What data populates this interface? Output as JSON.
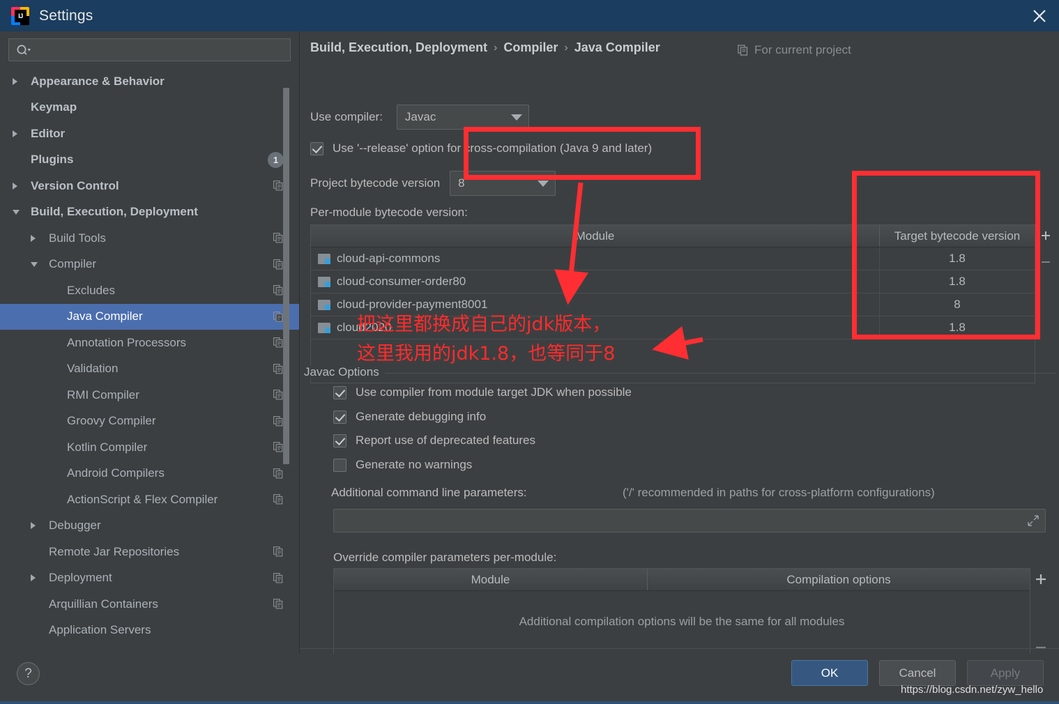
{
  "window": {
    "title": "Settings",
    "logo_text": "IJ",
    "close_label": "✕"
  },
  "sidebar": {
    "search": {
      "placeholder": "",
      "value": ""
    },
    "items": [
      {
        "label": "Appearance & Behavior",
        "indent": 0,
        "arrow": "right",
        "bold": true,
        "badge": null,
        "copy": false,
        "selected": false
      },
      {
        "label": "Keymap",
        "indent": 0,
        "arrow": "none",
        "bold": true,
        "badge": null,
        "copy": false,
        "selected": false
      },
      {
        "label": "Editor",
        "indent": 0,
        "arrow": "right",
        "bold": true,
        "badge": null,
        "copy": false,
        "selected": false
      },
      {
        "label": "Plugins",
        "indent": 0,
        "arrow": "none",
        "bold": true,
        "badge": "1",
        "copy": false,
        "selected": false
      },
      {
        "label": "Version Control",
        "indent": 0,
        "arrow": "right",
        "bold": true,
        "badge": null,
        "copy": true,
        "selected": false
      },
      {
        "label": "Build, Execution, Deployment",
        "indent": 0,
        "arrow": "down",
        "bold": true,
        "badge": null,
        "copy": false,
        "selected": false
      },
      {
        "label": "Build Tools",
        "indent": 1,
        "arrow": "right",
        "bold": false,
        "badge": null,
        "copy": true,
        "selected": false
      },
      {
        "label": "Compiler",
        "indent": 1,
        "arrow": "down",
        "bold": false,
        "badge": null,
        "copy": true,
        "selected": false
      },
      {
        "label": "Excludes",
        "indent": 2,
        "arrow": "none",
        "bold": false,
        "badge": null,
        "copy": true,
        "selected": false
      },
      {
        "label": "Java Compiler",
        "indent": 2,
        "arrow": "none",
        "bold": false,
        "badge": null,
        "copy": true,
        "selected": true
      },
      {
        "label": "Annotation Processors",
        "indent": 2,
        "arrow": "none",
        "bold": false,
        "badge": null,
        "copy": true,
        "selected": false
      },
      {
        "label": "Validation",
        "indent": 2,
        "arrow": "none",
        "bold": false,
        "badge": null,
        "copy": true,
        "selected": false
      },
      {
        "label": "RMI Compiler",
        "indent": 2,
        "arrow": "none",
        "bold": false,
        "badge": null,
        "copy": true,
        "selected": false
      },
      {
        "label": "Groovy Compiler",
        "indent": 2,
        "arrow": "none",
        "bold": false,
        "badge": null,
        "copy": true,
        "selected": false
      },
      {
        "label": "Kotlin Compiler",
        "indent": 2,
        "arrow": "none",
        "bold": false,
        "badge": null,
        "copy": true,
        "selected": false
      },
      {
        "label": "Android Compilers",
        "indent": 2,
        "arrow": "none",
        "bold": false,
        "badge": null,
        "copy": true,
        "selected": false
      },
      {
        "label": "ActionScript & Flex Compiler",
        "indent": 2,
        "arrow": "none",
        "bold": false,
        "badge": null,
        "copy": true,
        "selected": false
      },
      {
        "label": "Debugger",
        "indent": 1,
        "arrow": "right",
        "bold": false,
        "badge": null,
        "copy": false,
        "selected": false
      },
      {
        "label": "Remote Jar Repositories",
        "indent": 1,
        "arrow": "none",
        "bold": false,
        "badge": null,
        "copy": true,
        "selected": false
      },
      {
        "label": "Deployment",
        "indent": 1,
        "arrow": "right",
        "bold": false,
        "badge": null,
        "copy": true,
        "selected": false
      },
      {
        "label": "Arquillian Containers",
        "indent": 1,
        "arrow": "none",
        "bold": false,
        "badge": null,
        "copy": true,
        "selected": false
      },
      {
        "label": "Application Servers",
        "indent": 1,
        "arrow": "none",
        "bold": false,
        "badge": null,
        "copy": false,
        "selected": false
      }
    ]
  },
  "main": {
    "breadcrumb": {
      "part1": "Build, Execution, Deployment",
      "part2": "Compiler",
      "part3": "Java Compiler",
      "separator": "›"
    },
    "for_current_project": "For current project",
    "use_compiler_label": "Use compiler:",
    "use_compiler_value": "Javac",
    "release_option_label": "Use '--release' option for cross-compilation (Java 9 and later)",
    "release_option_checked": true,
    "project_bytecode_label": "Project bytecode version",
    "project_bytecode_value": "8",
    "per_module_label": "Per-module bytecode version:",
    "module_table": {
      "headers": [
        "Module",
        "Target bytecode version"
      ],
      "rows": [
        {
          "module": "cloud-api-commons",
          "target": "1.8"
        },
        {
          "module": "cloud-consumer-order80",
          "target": "1.8"
        },
        {
          "module": "cloud-provider-payment8001",
          "target": "8"
        },
        {
          "module": "cloud2020",
          "target": "1.8"
        }
      ],
      "add_label": "+",
      "remove_label": "−"
    },
    "javac_options": {
      "group_title": "Javac Options",
      "checkboxes": [
        {
          "label": "Use compiler from module target JDK when possible",
          "checked": true
        },
        {
          "label": "Generate debugging info",
          "checked": true
        },
        {
          "label": "Report use of deprecated features",
          "checked": true
        },
        {
          "label": "Generate no warnings",
          "checked": false
        }
      ],
      "additional_params_label": "Additional command line parameters:",
      "additional_params_hint": "('/' recommended in paths for cross-platform configurations)",
      "additional_params_value": "",
      "override_label": "Override compiler parameters per-module:",
      "override_table": {
        "headers": [
          "Module",
          "Compilation options"
        ],
        "empty_message": "Additional compilation options will be the same for all modules",
        "add_label": "+",
        "remove_label": "−"
      }
    }
  },
  "annotations": {
    "accent_color": "#ff2e32",
    "line1": "把这里都换成自己的jdk版本，",
    "line2": "这里我用的jdk1.8，也等同于8"
  },
  "footer": {
    "help_label": "?",
    "ok_label": "OK",
    "cancel_label": "Cancel",
    "apply_label": "Apply",
    "watermark": "https://blog.csdn.net/zyw_hello"
  }
}
